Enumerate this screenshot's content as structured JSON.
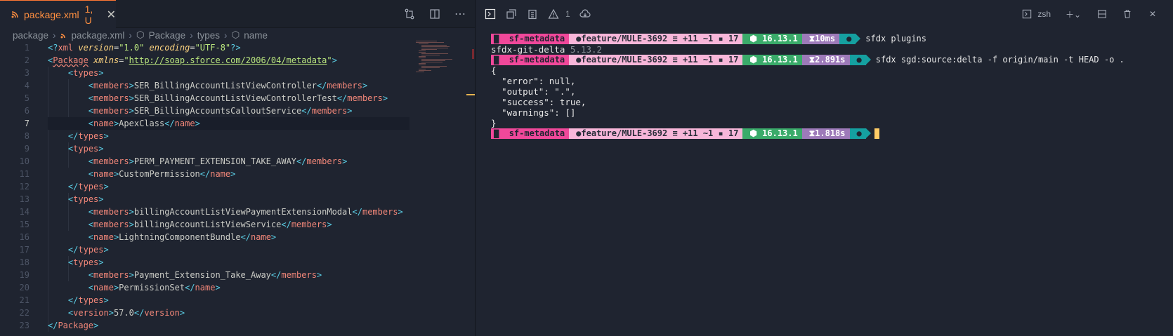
{
  "editor": {
    "tab": {
      "title": "package.xml",
      "status": "1, U"
    },
    "breadcrumb": [
      "package",
      "package.xml",
      "Package",
      "types",
      "name"
    ],
    "active_line": 7,
    "lines": [
      {
        "n": "1"
      },
      {
        "n": "2"
      },
      {
        "n": "3"
      },
      {
        "n": "4"
      },
      {
        "n": "5"
      },
      {
        "n": "6"
      },
      {
        "n": "7"
      },
      {
        "n": "8"
      },
      {
        "n": "9"
      },
      {
        "n": "10"
      },
      {
        "n": "11"
      },
      {
        "n": "12"
      },
      {
        "n": "13"
      },
      {
        "n": "14"
      },
      {
        "n": "15"
      },
      {
        "n": "16"
      },
      {
        "n": "17"
      },
      {
        "n": "18"
      },
      {
        "n": "19"
      },
      {
        "n": "20"
      },
      {
        "n": "21"
      },
      {
        "n": "22"
      },
      {
        "n": "23"
      }
    ],
    "code": {
      "decl": {
        "open": "<?",
        "name": "xml",
        "a1": "version",
        "v1": "\"1.0\"",
        "a2": "encoding",
        "v2": "\"UTF-8\"",
        "close": "?>"
      },
      "pkg_open": {
        "name": "Package",
        "attr": "xmlns",
        "val": "http://soap.sforce.com/2006/04/metadata"
      },
      "members": [
        "SER_BillingAccountListViewController",
        "SER_BillingAccountListViewControllerTest",
        "SER_BillingAccountsCalloutService",
        "PERM_PAYMENT_EXTENSION_TAKE_AWAY",
        "billingAccountListViewPaymentExtensionModal",
        "billingAccountListViewService",
        "Payment_Extension_Take_Away"
      ],
      "names": [
        "ApexClass",
        "CustomPermission",
        "LightningComponentBundle",
        "PermissionSet"
      ],
      "version": "57.0",
      "tags": {
        "types": "types",
        "members": "members",
        "name": "name",
        "version": "version",
        "package": "Package"
      }
    }
  },
  "terminal": {
    "badge_count": "1",
    "shell": "zsh",
    "prompt": {
      "dir": "sf-metadata",
      "branch": "feature/MULE-3692",
      "git_stats": "≡ +11 ~1",
      "stash": "17",
      "node": "16.13.1"
    },
    "runs": [
      {
        "time": "10ms",
        "cmd": "sfdx plugins"
      },
      {
        "time": "2.891s",
        "cmd": "sfdx sgd:source:delta -f origin/main -t HEAD -o ."
      },
      {
        "time": "1.818s",
        "cmd": ""
      }
    ],
    "plugin_line": {
      "name": "sfdx-git-delta",
      "version": "5.13.2"
    },
    "json_out": [
      "{",
      "  \"error\": null,",
      "  \"output\": \".\",",
      "  \"success\": true,",
      "  \"warnings\": []",
      "}"
    ]
  },
  "colors": {
    "accent": "#ff8f40",
    "seg_dir": "#f0489a",
    "seg_git": "#f7b6d9",
    "seg_node": "#3aab6a",
    "seg_time": "#9d7ab9",
    "seg_end": "#15a0a0"
  }
}
